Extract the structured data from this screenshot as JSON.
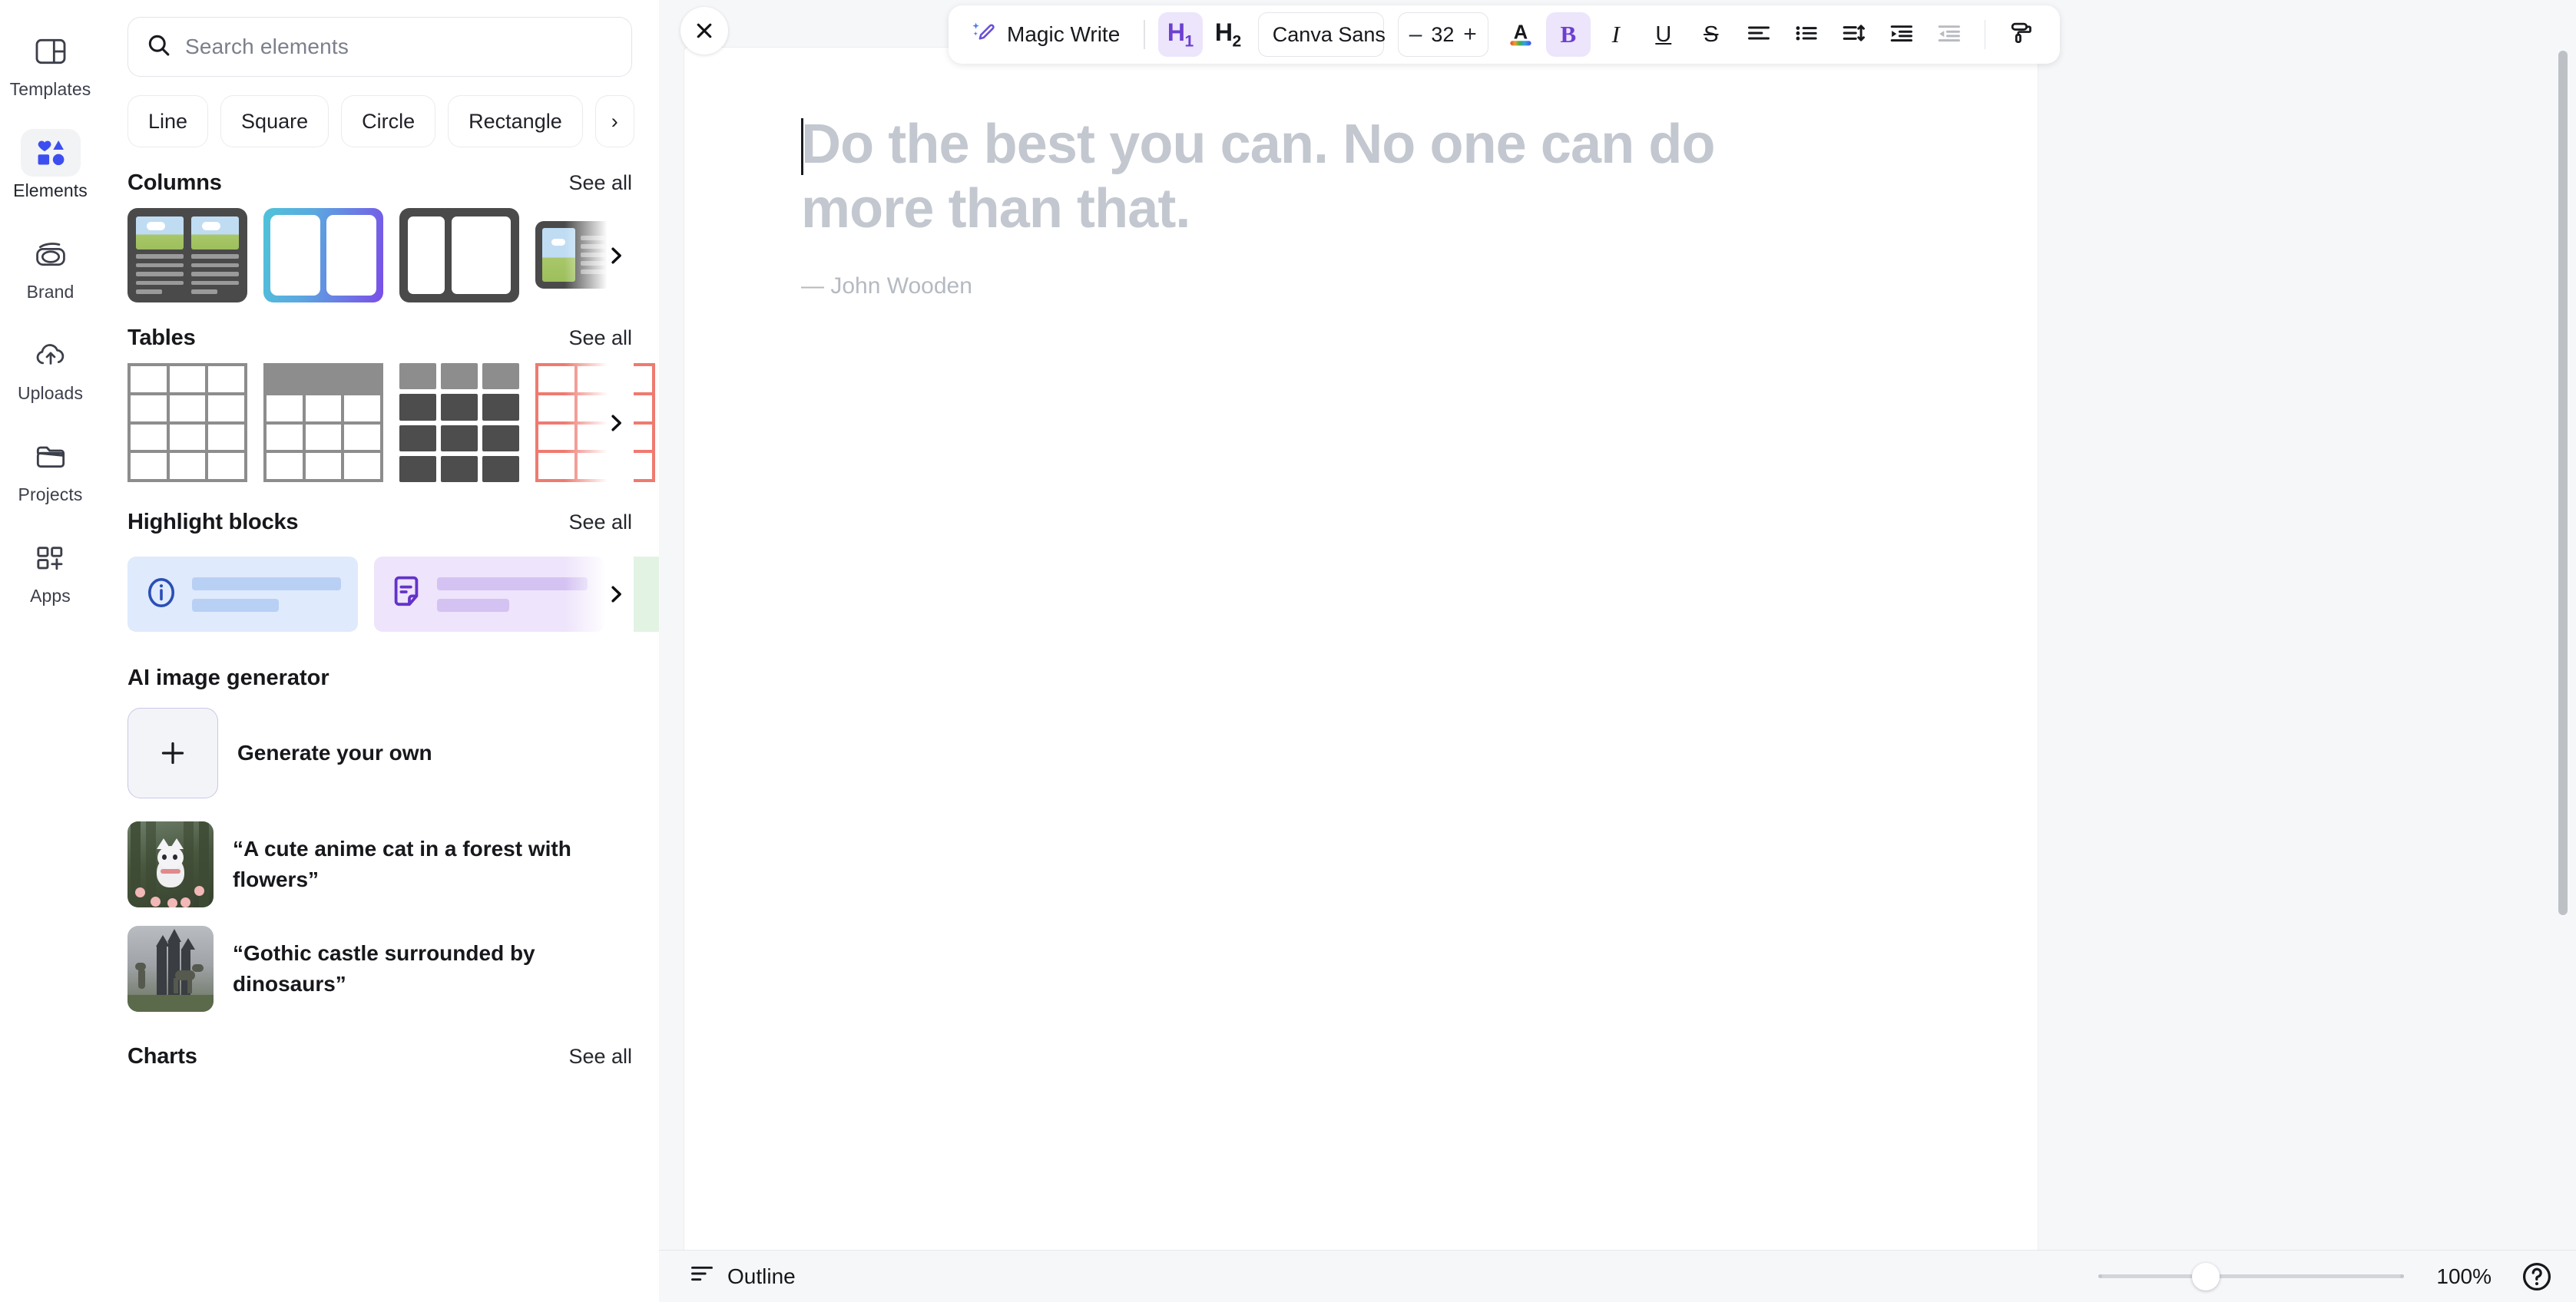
{
  "rail": {
    "items": [
      {
        "label": "Templates",
        "icon": "templates-icon",
        "active": false
      },
      {
        "label": "Elements",
        "icon": "elements-icon",
        "active": true
      },
      {
        "label": "Brand",
        "icon": "brand-icon",
        "active": false
      },
      {
        "label": "Uploads",
        "icon": "uploads-icon",
        "active": false
      },
      {
        "label": "Projects",
        "icon": "projects-icon",
        "active": false
      },
      {
        "label": "Apps",
        "icon": "apps-icon",
        "active": false
      }
    ]
  },
  "panel": {
    "search": {
      "placeholder": "Search elements",
      "value": "",
      "icon": "search-icon"
    },
    "chips": [
      "Line",
      "Square",
      "Circle",
      "Rectangle"
    ],
    "chip_next": "›",
    "sections": [
      {
        "title": "Columns",
        "see_all": "See all",
        "next": "›"
      },
      {
        "title": "Tables",
        "see_all": "See all",
        "next": "›"
      },
      {
        "title": "Highlight blocks",
        "see_all": "See all",
        "next": "›"
      },
      {
        "title": "Charts",
        "see_all": "See all",
        "next": "›"
      }
    ],
    "ai": {
      "title": "AI image generator",
      "generate_label": "Generate your own",
      "generate_icon": "plus-icon",
      "prompts": [
        {
          "text": "“A cute anime cat in a forest with flowers”",
          "thumb": "anime-cat-thumbnail"
        },
        {
          "text": "“Gothic castle surrounded by dinosaurs”",
          "thumb": "gothic-castle-thumbnail"
        }
      ]
    }
  },
  "toolbar": {
    "close_icon": "close-icon",
    "magic_write": {
      "label": "Magic Write",
      "icon": "magic-wand-icon"
    },
    "h1": {
      "label": "H",
      "sub": "1",
      "active": true
    },
    "h2": {
      "label": "H",
      "sub": "2",
      "active": false
    },
    "font_family": "Canva Sans",
    "font_size": {
      "value": "32",
      "minus": "–",
      "plus": "+"
    },
    "text_color": {
      "icon": "text-color-icon",
      "label": "A"
    },
    "bold": {
      "label": "B",
      "active": true
    },
    "italic": {
      "label": "I",
      "active": false
    },
    "underline": {
      "label": "U",
      "active": false
    },
    "strikethrough": {
      "label": "S",
      "active": false
    },
    "align": {
      "icon": "align-left-icon"
    },
    "bullets": {
      "icon": "bulleted-list-icon"
    },
    "line_spacing": {
      "icon": "line-spacing-icon"
    },
    "indent_increase": {
      "icon": "indent-increase-icon"
    },
    "indent_decrease": {
      "icon": "indent-decrease-icon",
      "disabled": true
    },
    "format_painter": {
      "icon": "paint-roller-icon"
    }
  },
  "document": {
    "heading": "Do the best you can. No one can do more than that.",
    "attribution": "— John Wooden"
  },
  "statusbar": {
    "outline": {
      "label": "Outline",
      "icon": "outline-icon"
    },
    "zoom_value": "100%",
    "zoom_percent": 100,
    "help_icon": "help-icon"
  },
  "colors": {
    "accent_purple": "#6c3fd1",
    "accent_purple_bg": "#ece5fb",
    "elements_blue": "#3d4ef0",
    "canvas_bg": "#f6f7f9",
    "page_white": "#ffffff",
    "placeholder_text": "#c3c7cf"
  }
}
